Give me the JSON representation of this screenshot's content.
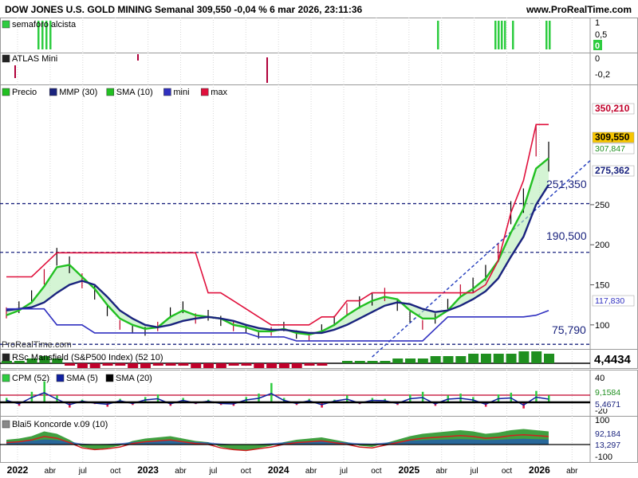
{
  "header": {
    "title": "DOW JONES U.S. GOLD MINING Semanal 309,550 -0,04 % 6 mar 2026, 23:11:36",
    "site": "www.ProRealTime.com"
  },
  "watermark": "ProRealTime.com",
  "chart_data": [
    {
      "type": "bar",
      "title": "semaforo alcista",
      "ticks": [
        "1",
        "0,5"
      ],
      "value_label": "0",
      "colors": {
        "bar": "#2ecc40"
      }
    },
    {
      "type": "bar",
      "title": "ATLAS Mini",
      "ticks": [
        "-0,2"
      ],
      "value_label": "0",
      "colors": {
        "bar": "#b0003a"
      }
    },
    {
      "type": "line",
      "legend": [
        "Precio",
        "MMP (30)",
        "SMA (10)",
        "mini",
        "max"
      ],
      "colors": {
        "price": "#000000",
        "mmp": "#1a237e",
        "sma": "#22c022",
        "mini": "#3030c0",
        "max": "#e0103c"
      },
      "ylim": [
        70,
        400
      ],
      "yticks": [
        100,
        150,
        200,
        250
      ],
      "x_labels": [
        "2022",
        "abr",
        "jul",
        "oct",
        "2023",
        "abr",
        "jul",
        "oct",
        "2024",
        "abr",
        "jul",
        "oct",
        "2025",
        "abr",
        "jul",
        "oct",
        "2026",
        "abr"
      ],
      "price_labels": {
        "max": "350,210",
        "last": "309,550",
        "sma": "307,847",
        "mmp": "275,362",
        "mini": "117,830",
        "lvl1": "251,350",
        "lvl2": "190,500",
        "lvl3": "75,790"
      },
      "levels": [
        251.35,
        190.5,
        75.79
      ],
      "series": [
        {
          "key": "price",
          "values": [
            115,
            122,
            135,
            160,
            185,
            175,
            155,
            140,
            118,
            100,
            95,
            92,
            98,
            115,
            122,
            108,
            112,
            105,
            98,
            95,
            88,
            92,
            98,
            88,
            85,
            95,
            105,
            120,
            128,
            132,
            138,
            125,
            110,
            100,
            108,
            125,
            142,
            150,
            165,
            190,
            240,
            255,
            330,
            310
          ]
        },
        {
          "key": "sma",
          "values": [
            112,
            118,
            128,
            148,
            172,
            175,
            160,
            145,
            125,
            108,
            100,
            95,
            97,
            110,
            118,
            112,
            110,
            108,
            100,
            97,
            92,
            92,
            95,
            90,
            88,
            92,
            100,
            112,
            122,
            130,
            135,
            132,
            118,
            108,
            108,
            118,
            135,
            145,
            158,
            180,
            215,
            245,
            295,
            308
          ]
        },
        {
          "key": "mmp",
          "values": [
            118,
            120,
            122,
            128,
            140,
            150,
            155,
            150,
            135,
            118,
            108,
            100,
            97,
            100,
            105,
            108,
            110,
            108,
            105,
            100,
            96,
            94,
            94,
            92,
            90,
            90,
            94,
            100,
            108,
            116,
            124,
            128,
            126,
            120,
            116,
            118,
            124,
            132,
            142,
            158,
            185,
            210,
            250,
            275
          ]
        },
        {
          "key": "mini",
          "values": [
            120,
            120,
            120,
            120,
            100,
            100,
            100,
            90,
            90,
            90,
            90,
            90,
            90,
            90,
            90,
            90,
            90,
            90,
            90,
            90,
            85,
            85,
            85,
            80,
            80,
            80,
            80,
            80,
            80,
            80,
            80,
            80,
            80,
            80,
            95,
            110,
            110,
            110,
            110,
            110,
            110,
            110,
            112,
            118
          ]
        },
        {
          "key": "max",
          "values": [
            160,
            160,
            160,
            175,
            190,
            190,
            190,
            190,
            190,
            190,
            190,
            190,
            190,
            190,
            190,
            190,
            140,
            140,
            130,
            120,
            110,
            100,
            100,
            100,
            100,
            110,
            110,
            130,
            130,
            140,
            140,
            140,
            140,
            140,
            140,
            140,
            140,
            140,
            150,
            180,
            240,
            280,
            350,
            350
          ]
        }
      ]
    },
    {
      "type": "area",
      "title": "RSc Mansfield (S&P500 Index) (52 10)",
      "value_label": "4,4434",
      "colors": {
        "pos": "#1f8f1f",
        "neg": "#c0002a"
      },
      "values": [
        1,
        1,
        2,
        3,
        2,
        -1,
        -2,
        -2,
        -1,
        -1,
        -2,
        -2,
        -1,
        -1,
        -1,
        -2,
        -2,
        -2,
        -1,
        -1,
        -2,
        -2,
        -2,
        -2,
        -1,
        -1,
        0,
        1,
        1,
        1,
        1,
        2,
        2,
        2,
        3,
        3,
        3,
        4,
        4,
        4,
        4,
        5,
        5,
        4
      ]
    },
    {
      "type": "bar",
      "title": "CPM (52)",
      "legend": [
        "SMA (5)",
        "SMA (20)"
      ],
      "ticks": [
        "40",
        "0",
        "-20"
      ],
      "value_labels": [
        "9,1584",
        "5,4671"
      ],
      "colors": {
        "pos": "#2ecc40",
        "neg": "#e0103c",
        "sma5": "#1020a0",
        "sma20": "#000000",
        "ref": "#c0002a"
      },
      "values": [
        5,
        -4,
        12,
        24,
        8,
        -6,
        3,
        -2,
        -5,
        4,
        -3,
        6,
        9,
        -4,
        5,
        -2,
        3,
        -3,
        -4,
        6,
        10,
        22,
        5,
        -3,
        4,
        -6,
        3,
        8,
        -2,
        5,
        4,
        -3,
        9,
        12,
        -4,
        8,
        10,
        6,
        -5,
        9,
        11,
        -7,
        13,
        8
      ]
    },
    {
      "type": "area",
      "title": "Blai5 Koncorde v.09 (10)",
      "ticks": [
        "100",
        "-100"
      ],
      "value_labels": [
        "92,184",
        "13,297"
      ],
      "colors": {
        "green": "#1f8f1f",
        "blue": "#2050c0",
        "purple": "#8030a0",
        "red": "#d02020"
      },
      "values": [
        20,
        25,
        35,
        55,
        45,
        20,
        -10,
        -20,
        -15,
        -5,
        15,
        25,
        30,
        35,
        25,
        15,
        10,
        -10,
        -20,
        -25,
        -15,
        -5,
        10,
        20,
        25,
        30,
        20,
        10,
        -5,
        -10,
        5,
        20,
        35,
        45,
        50,
        55,
        60,
        55,
        45,
        50,
        60,
        65,
        60,
        55
      ]
    }
  ]
}
